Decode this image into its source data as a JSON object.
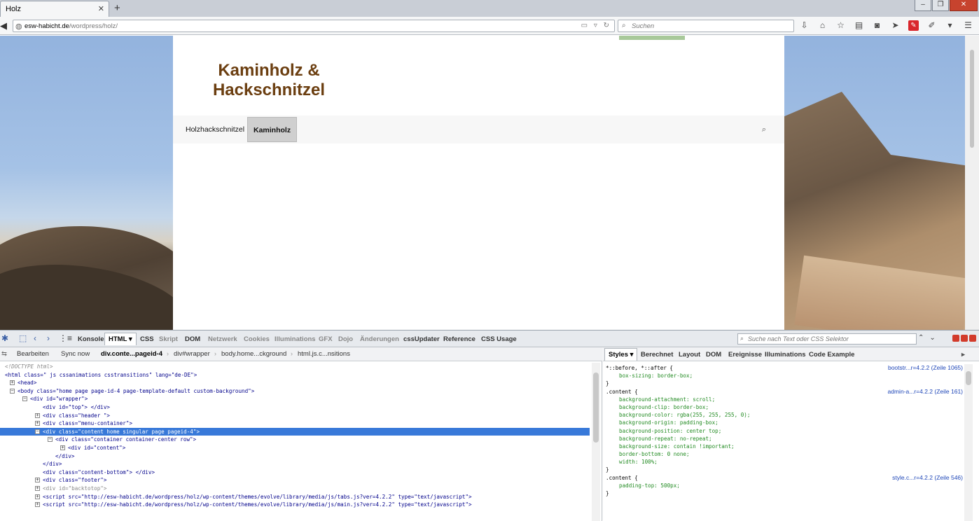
{
  "browser": {
    "tab_title": "Holz",
    "tab_close": "✕",
    "new_tab": "+",
    "url_host": "esw-habicht.de",
    "url_path": "/wordpress/holz/",
    "search_placeholder": "Suchen",
    "window_controls": [
      "–",
      "❐",
      "✕"
    ],
    "toolbar_icons": [
      "download-icon",
      "home-icon",
      "bookmark-star-icon",
      "reading-list-icon",
      "pocket-icon",
      "send-icon",
      "addon-red-icon",
      "addon-wrench-icon",
      "chevron-down-icon",
      "menu-icon"
    ]
  },
  "website": {
    "logo_line1": "Kaminholz &",
    "logo_line2": "Hackschnitzel",
    "nav": [
      {
        "label": "Holzhackschnitzel",
        "active": false
      },
      {
        "label": "Kaminholz",
        "active": true
      }
    ],
    "colors": {
      "logo": "#6b3e10",
      "nav_active": "#cfcfcf",
      "top_strip": "#a8c99a"
    }
  },
  "devtools": {
    "tabs": [
      "Konsole",
      "HTML ▾",
      "CSS",
      "Skript",
      "DOM",
      "Netzwerk",
      "Cookies",
      "Illuminations",
      "GFX",
      "Dojo",
      "Änderungen",
      "cssUpdater",
      "Reference",
      "CSS Usage"
    ],
    "search_placeholder": "Suche nach Text oder CSS Selektor",
    "toolbar": {
      "edit": "Bearbeiten",
      "sync": "Sync now"
    },
    "breadcrumbs": [
      "div.conte...pageid-4",
      "div#wrapper",
      "body.home...ckground",
      "html.js.c...nsitions"
    ],
    "side_tabs": [
      "Styles ▾",
      "Berechnet",
      "Layout",
      "DOM",
      "Ereignisse",
      "Illuminations",
      "Code Example"
    ],
    "html_tree": [
      {
        "text": "<!DOCTYPE html>"
      },
      {
        "text": "<html class=\" js cssanimations csstransitions\" lang=\"de-DE\">"
      },
      {
        "text": "<head>"
      },
      {
        "text": "<body class=\"home page page-id-4 page-template-default custom-background\">"
      },
      {
        "text": "<div id=\"wrapper\">"
      },
      {
        "text": "<div id=\"top\"> </div>"
      },
      {
        "text": "<div class=\"header \">"
      },
      {
        "text": "<div class=\"menu-container\">"
      },
      {
        "text": "<div class=\"content home singular page pageid-4\">"
      },
      {
        "text": "<div class=\"container container-center row\">"
      },
      {
        "text": "<div id=\"content\">"
      },
      {
        "text": "</div>"
      },
      {
        "text": "</div>"
      },
      {
        "text": "<div class=\"content-bottom\"> </div>"
      },
      {
        "text": "<div class=\"footer\">"
      },
      {
        "text": "<div id=\"backtotop\">"
      },
      {
        "text": "<script src=\"http://esw-habicht.de/wordpress/holz/wp-content/themes/evolve/library/media/js/tabs.js?ver=4.2.2\" type=\"text/javascript\">"
      },
      {
        "text": "<script src=\"http://esw-habicht.de/wordpress/holz/wp-content/themes/evolve/library/media/js/main.js?ver=4.2.2\" type=\"text/javascript\">"
      }
    ],
    "css_rules": [
      {
        "text": "*::before, *::after {",
        "source": "bootstr...r=4.2.2 (Zeile 1065)"
      },
      {
        "text": "box-sizing: border-box;",
        "prop": true
      },
      {
        "text": "}"
      },
      {
        "text": ".content {",
        "source": "admin-a...r=4.2.2 (Zeile 161)"
      },
      {
        "text": "background-attachment: scroll;",
        "prop": true
      },
      {
        "text": "background-clip: border-box;",
        "prop": true
      },
      {
        "text": "background-color: rgba(255, 255, 255, 0);",
        "prop": true
      },
      {
        "text": "background-origin: padding-box;",
        "prop": true
      },
      {
        "text": "background-position: center top;",
        "prop": true
      },
      {
        "text": "background-repeat: no-repeat;",
        "prop": true
      },
      {
        "text": "background-size: contain !important;",
        "prop": true
      },
      {
        "text": "border-bottom: 0 none;",
        "prop": true
      },
      {
        "text": "width: 100%;",
        "prop": true
      },
      {
        "text": "}"
      },
      {
        "text": ".content {",
        "source": "style.c...r=4.2.2 (Zeile 546)"
      },
      {
        "text": "padding-top: 500px;",
        "prop": true
      },
      {
        "text": "}"
      }
    ]
  }
}
